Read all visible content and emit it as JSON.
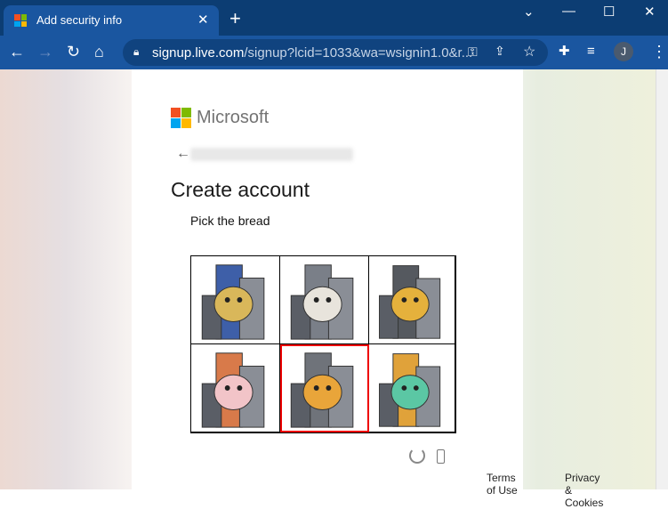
{
  "browser": {
    "tab_title": "Add security info",
    "url_host": "signup.live.com",
    "url_path": "/signup?lcid=1033&wa=wsignin1.0&r...",
    "profile_initial": "J"
  },
  "page": {
    "brand": "Microsoft",
    "heading": "Create account",
    "prompt": "Pick the bread",
    "captcha": [
      {
        "subject": "owl",
        "selected": false
      },
      {
        "subject": "cat",
        "selected": false
      },
      {
        "subject": "bird",
        "selected": false
      },
      {
        "subject": "pig",
        "selected": false
      },
      {
        "subject": "bread",
        "selected": true
      },
      {
        "subject": "frog",
        "selected": false
      }
    ],
    "footer": {
      "terms": "Terms of Use",
      "privacy": "Privacy & Cookies"
    }
  },
  "colors": {
    "selected_border": "#e00000",
    "chrome_dark": "#0c3d73",
    "chrome": "#1a56a0"
  }
}
